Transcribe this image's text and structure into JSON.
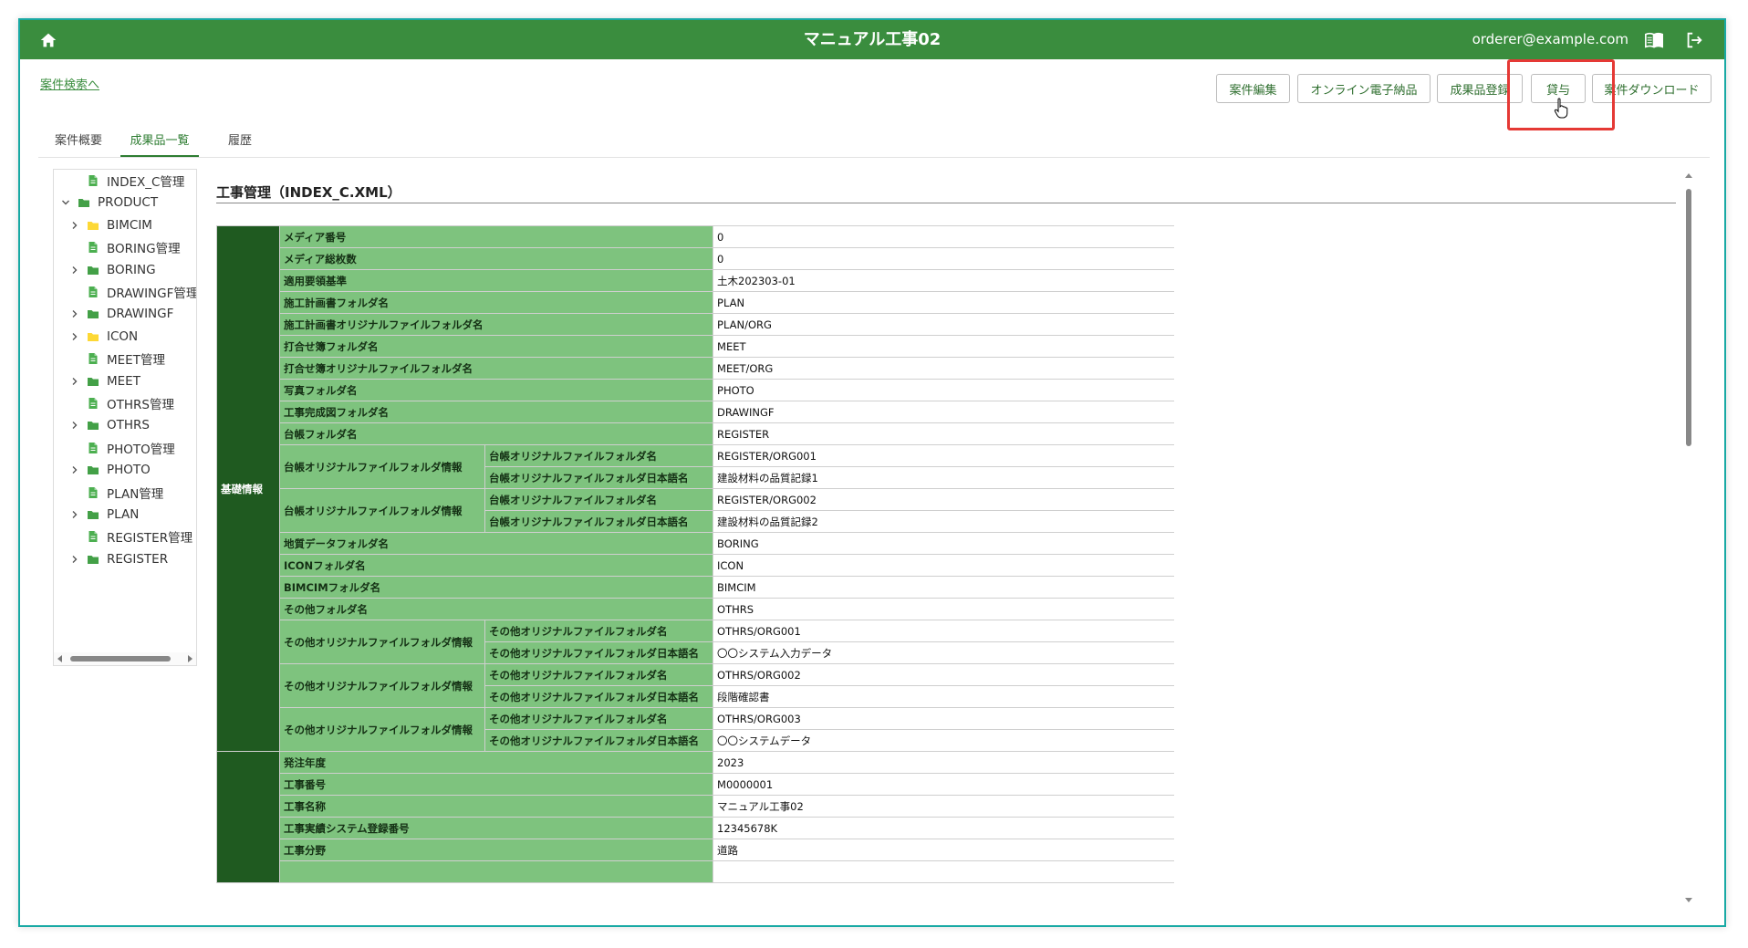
{
  "header": {
    "title": "マニュアル工事02",
    "user_email": "orderer@example.com",
    "colors": {
      "bar": "#3a8d3e",
      "border": "#19a9a4",
      "highlight": "#e53935"
    },
    "icons": [
      "home-icon",
      "manual-book-icon",
      "logout-icon"
    ]
  },
  "nav": {
    "back_link": "案件検索へ"
  },
  "actions": {
    "edit": "案件編集",
    "online_delivery": "オンライン電子納品",
    "deliverable_register": "成果品登録",
    "lend": "貸与",
    "download": "案件ダウンロード"
  },
  "tabs": [
    {
      "label": "案件概要"
    },
    {
      "label": "成果品一覧"
    },
    {
      "label": "履歴"
    }
  ],
  "tree": {
    "items": [
      {
        "label": "INDEX_C管理"
      },
      {
        "label": "PRODUCT"
      },
      {
        "label": "BIMCIM"
      },
      {
        "label": "BORING管理"
      },
      {
        "label": "BORING"
      },
      {
        "label": "DRAWINGF管理"
      },
      {
        "label": "DRAWINGF"
      },
      {
        "label": "ICON"
      },
      {
        "label": "MEET管理"
      },
      {
        "label": "MEET"
      },
      {
        "label": "OTHRS管理"
      },
      {
        "label": "OTHRS"
      },
      {
        "label": "PHOTO管理"
      },
      {
        "label": "PHOTO"
      },
      {
        "label": "PLAN管理"
      },
      {
        "label": "PLAN"
      },
      {
        "label": "REGISTER管理"
      },
      {
        "label": "REGISTER"
      }
    ]
  },
  "content": {
    "title": "工事管理（INDEX_C.XML）",
    "section1": "基礎情報",
    "section2": "",
    "rows": [
      {
        "label": "メディア番号",
        "value": "0"
      },
      {
        "label": "メディア総枚数",
        "value": "0"
      },
      {
        "label": "適用要領基準",
        "value": "土木202303-01"
      },
      {
        "label": "施工計画書フォルダ名",
        "value": "PLAN"
      },
      {
        "label": "施工計画書オリジナルファイルフォルダ名",
        "value": "PLAN/ORG"
      },
      {
        "label": "打合せ簿フォルダ名",
        "value": "MEET"
      },
      {
        "label": "打合せ簿オリジナルファイルフォルダ名",
        "value": "MEET/ORG"
      },
      {
        "label": "写真フォルダ名",
        "value": "PHOTO"
      },
      {
        "label": "工事完成図フォルダ名",
        "value": "DRAWINGF"
      },
      {
        "label": "台帳フォルダ名",
        "value": "REGISTER"
      },
      {
        "group": "台帳オリジナルファイルフォルダ情報",
        "label": "台帳オリジナルファイルフォルダ名",
        "value": "REGISTER/ORG001"
      },
      {
        "label": "台帳オリジナルファイルフォルダ日本語名",
        "value": "建設材料の品質記録1"
      },
      {
        "group": "台帳オリジナルファイルフォルダ情報",
        "label": "台帳オリジナルファイルフォルダ名",
        "value": "REGISTER/ORG002"
      },
      {
        "label": "台帳オリジナルファイルフォルダ日本語名",
        "value": "建設材料の品質記録2"
      },
      {
        "label": "地質データフォルダ名",
        "value": "BORING"
      },
      {
        "label": "ICONフォルダ名",
        "value": "ICON"
      },
      {
        "label": "BIMCIMフォルダ名",
        "value": "BIMCIM"
      },
      {
        "label": "その他フォルダ名",
        "value": "OTHRS"
      },
      {
        "group": "その他オリジナルファイルフォルダ情報",
        "label": "その他オリジナルファイルフォルダ名",
        "value": "OTHRS/ORG001"
      },
      {
        "label": "その他オリジナルファイルフォルダ日本語名",
        "value": "〇〇システム入力データ"
      },
      {
        "group": "その他オリジナルファイルフォルダ情報",
        "label": "その他オリジナルファイルフォルダ名",
        "value": "OTHRS/ORG002"
      },
      {
        "label": "その他オリジナルファイルフォルダ日本語名",
        "value": "段階確認書"
      },
      {
        "group": "その他オリジナルファイルフォルダ情報",
        "label": "その他オリジナルファイルフォルダ名",
        "value": "OTHRS/ORG003"
      },
      {
        "label": "その他オリジナルファイルフォルダ日本語名",
        "value": "〇〇システムデータ"
      },
      {
        "label": "発注年度",
        "value": "2023"
      },
      {
        "label": "工事番号",
        "value": "M0000001"
      },
      {
        "label": "工事名称",
        "value": "マニュアル工事02"
      },
      {
        "label": "工事実績システム登録番号",
        "value": "12345678K"
      },
      {
        "label": "工事分野",
        "value": "道路"
      },
      {
        "label": "",
        "value": ""
      }
    ]
  }
}
